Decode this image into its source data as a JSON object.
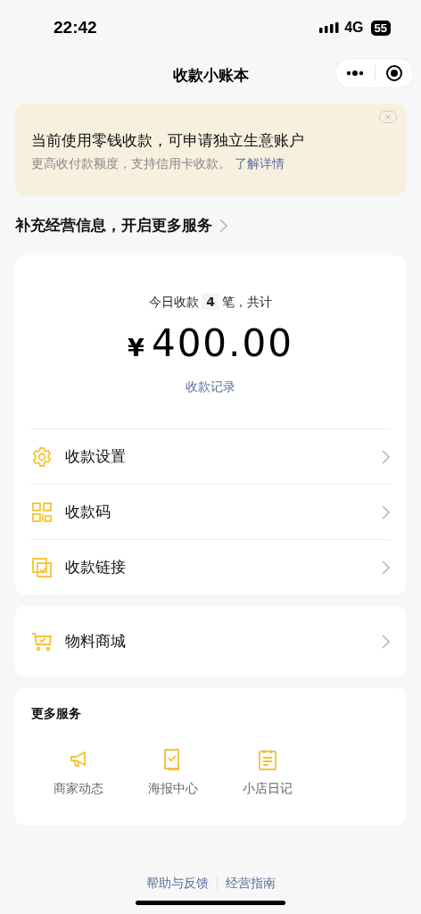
{
  "status_bar": {
    "time": "22:42",
    "network": "4G",
    "battery": "55"
  },
  "nav": {
    "title": "收款小账本"
  },
  "notice": {
    "title": "当前使用零钱收款，可申请独立生意账户",
    "text": "更高收付款额度，支持信用卡收款。",
    "link": "了解详情"
  },
  "promo": {
    "label": "补充经营信息，开启更多服务"
  },
  "summary": {
    "prefix": "今日收款",
    "count": "4",
    "suffix": "笔，共计",
    "currency": "¥",
    "amount": "400.00",
    "link": "收款记录"
  },
  "menu": [
    {
      "kind": "settings",
      "label": "收款设置"
    },
    {
      "kind": "qr",
      "label": "收款码"
    },
    {
      "kind": "link",
      "label": "收款链接"
    }
  ],
  "shop": [
    {
      "kind": "cart",
      "label": "物料商城"
    }
  ],
  "services": {
    "title": "更多服务",
    "items": [
      {
        "kind": "megaphone",
        "label": "商家动态"
      },
      {
        "kind": "poster",
        "label": "海报中心"
      },
      {
        "kind": "notes",
        "label": "小店日记"
      }
    ]
  },
  "footer": [
    "帮助与反馈",
    "经营指南"
  ]
}
